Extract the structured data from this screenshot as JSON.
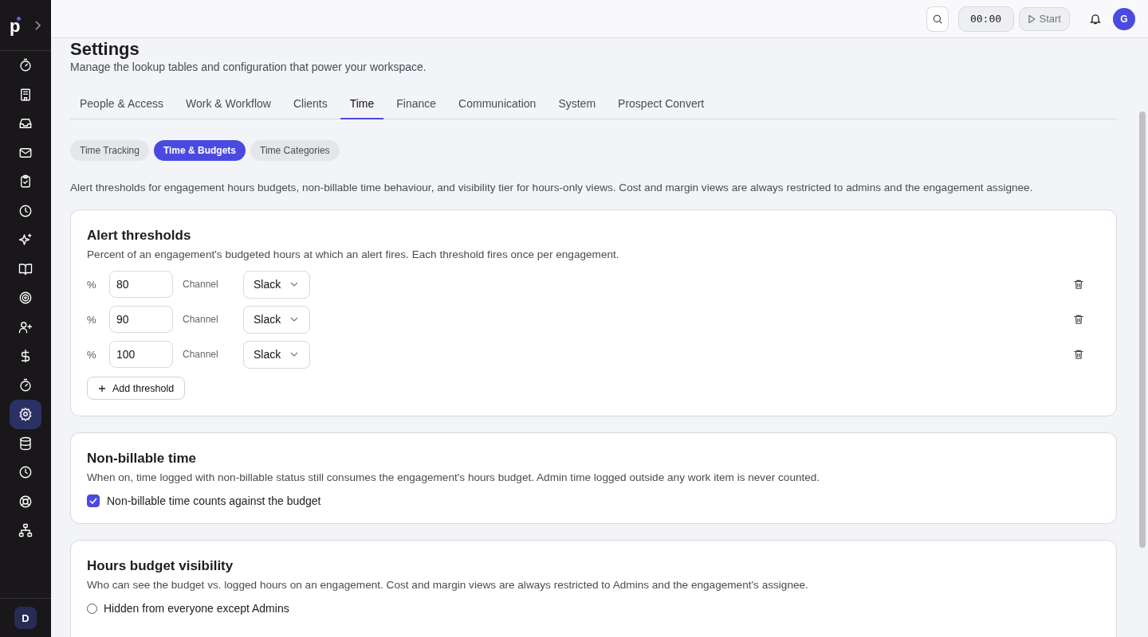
{
  "sidebar": {
    "logo": "p",
    "items": [
      {
        "kind": "timer",
        "selected": false
      },
      {
        "kind": "building",
        "selected": false
      },
      {
        "kind": "inbox",
        "selected": false
      },
      {
        "kind": "mail",
        "selected": false
      },
      {
        "kind": "clipboard",
        "selected": false
      },
      {
        "kind": "clock",
        "selected": false
      },
      {
        "kind": "sparkles",
        "selected": false
      },
      {
        "kind": "book",
        "selected": false
      },
      {
        "kind": "target",
        "selected": false
      },
      {
        "kind": "user-plus",
        "selected": false
      },
      {
        "kind": "dollar",
        "selected": false
      },
      {
        "kind": "timer",
        "selected": false
      },
      {
        "kind": "gear",
        "selected": true
      },
      {
        "kind": "database",
        "selected": false
      },
      {
        "kind": "clock",
        "selected": false
      },
      {
        "kind": "lifebuoy",
        "selected": false
      },
      {
        "kind": "network",
        "selected": false
      }
    ],
    "user_avatar": "D"
  },
  "header": {
    "timer": "00:00",
    "start_button": "Start",
    "avatar": "G"
  },
  "page": {
    "title": "Settings",
    "subtitle": "Manage the lookup tables and configuration that power your workspace."
  },
  "tabs": [
    {
      "label": "People & Access",
      "selected": false
    },
    {
      "label": "Work & Workflow",
      "selected": false
    },
    {
      "label": "Clients",
      "selected": false
    },
    {
      "label": "Time",
      "selected": true
    },
    {
      "label": "Finance",
      "selected": false
    },
    {
      "label": "Communication",
      "selected": false
    },
    {
      "label": "System",
      "selected": false
    },
    {
      "label": "Prospect Convert",
      "selected": false
    }
  ],
  "subtabs": [
    {
      "label": "Time Tracking",
      "selected": false
    },
    {
      "label": "Time & Budgets",
      "selected": true
    },
    {
      "label": "Time Categories",
      "selected": false
    }
  ],
  "description": "Alert thresholds for engagement hours budgets, non-billable time behaviour, and visibility tier for hours-only views. Cost and margin views are always restricted to admins and the engagement assignee.",
  "alert_thresholds": {
    "title": "Alert thresholds",
    "description": "Percent of an engagement's budgeted hours at which an alert fires. Each threshold fires once per engagement.",
    "rows": [
      {
        "unit": "%",
        "value": "80",
        "channel_label": "Channel",
        "channel": "Slack"
      },
      {
        "unit": "%",
        "value": "90",
        "channel_label": "Channel",
        "channel": "Slack"
      },
      {
        "unit": "%",
        "value": "100",
        "channel_label": "Channel",
        "channel": "Slack"
      }
    ],
    "add_button": "Add threshold"
  },
  "non_billable": {
    "title": "Non-billable time",
    "description": "When on, time logged with non-billable status still consumes the engagement's hours budget. Admin time logged outside any work item is never counted.",
    "checkbox": {
      "label": "Non-billable time counts against the budget",
      "checked": true
    }
  },
  "visibility": {
    "title": "Hours budget visibility",
    "description": "Who can see the budget vs. logged hours on an engagement. Cost and margin views are always restricted to Admins and the engagement's assignee.",
    "options": [
      {
        "label": "Hidden from everyone except Admins",
        "selected": false
      }
    ]
  }
}
